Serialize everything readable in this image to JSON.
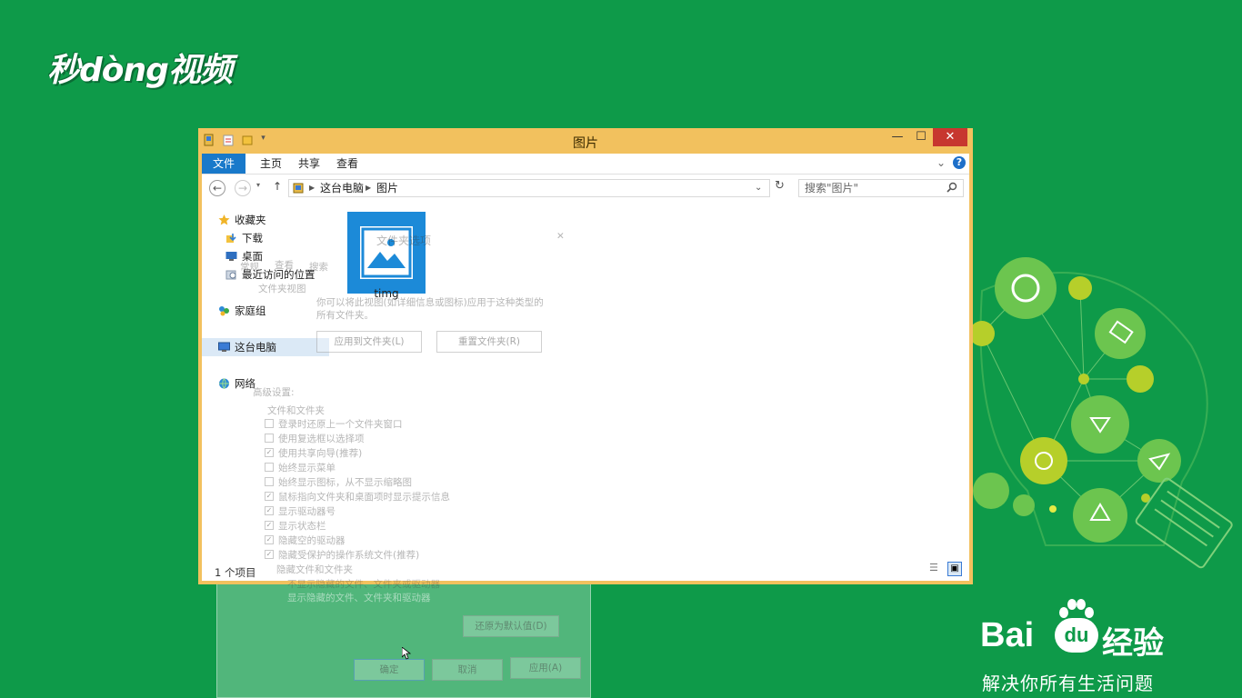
{
  "brand": {
    "logo_text": "秒dòng视频"
  },
  "explorer": {
    "title": "图片",
    "ribbon_tabs": [
      "文件",
      "主页",
      "共享",
      "查看"
    ],
    "breadcrumb": [
      "这台电脑",
      "图片"
    ],
    "search_placeholder": "搜索\"图片\"",
    "nav": {
      "favorites": "收藏夹",
      "downloads": "下载",
      "desktop": "桌面",
      "recent": "最近访问的位置",
      "homegroup": "家庭组",
      "this_pc": "这台电脑",
      "network": "网络"
    },
    "files": [
      {
        "name": "timg"
      }
    ],
    "status": "1 个项目"
  },
  "ghost_dialog": {
    "title": "文件夹选项",
    "tabs": [
      "常规",
      "查看",
      "搜索"
    ],
    "group_label": "文件夹视图",
    "description": "你可以将此视图(如详细信息或图标)应用于这种类型的所有文件夹。",
    "apply_button": "应用到文件夹(L)",
    "reset_button": "重置文件夹(R)",
    "advanced_label": "高级设置:",
    "tree_root": "文件和文件夹",
    "options": [
      {
        "label": "登录时还原上一个文件夹窗口",
        "checked": false
      },
      {
        "label": "使用复选框以选择项",
        "checked": false
      },
      {
        "label": "使用共享向导(推荐)",
        "checked": true
      },
      {
        "label": "始终显示菜单",
        "checked": false
      },
      {
        "label": "始终显示图标，从不显示缩略图",
        "checked": false
      },
      {
        "label": "鼠标指向文件夹和桌面项时显示提示信息",
        "checked": true
      },
      {
        "label": "显示驱动器号",
        "checked": true
      },
      {
        "label": "显示状态栏",
        "checked": true
      },
      {
        "label": "隐藏空的驱动器",
        "checked": true
      },
      {
        "label": "隐藏受保护的操作系统文件(推荐)",
        "checked": true
      }
    ],
    "hidden_group": "隐藏文件和文件夹",
    "hidden_opt1": "不显示隐藏的文件、文件夹或驱动器",
    "hidden_opt2": "显示隐藏的文件、文件夹和驱动器",
    "restore_button": "还原为默认值(D)",
    "ok_button": "确定",
    "cancel_button": "取消",
    "apply2_button": "应用(A)"
  },
  "baidu": {
    "bai": "Bai",
    "du": "du",
    "jingyan": "经验",
    "slogan": "解决你所有生活问题"
  },
  "colors": {
    "background": "#0e9a49",
    "window_frame": "#f2c15e",
    "accent": "#1979ca",
    "close": "#c7372f"
  }
}
